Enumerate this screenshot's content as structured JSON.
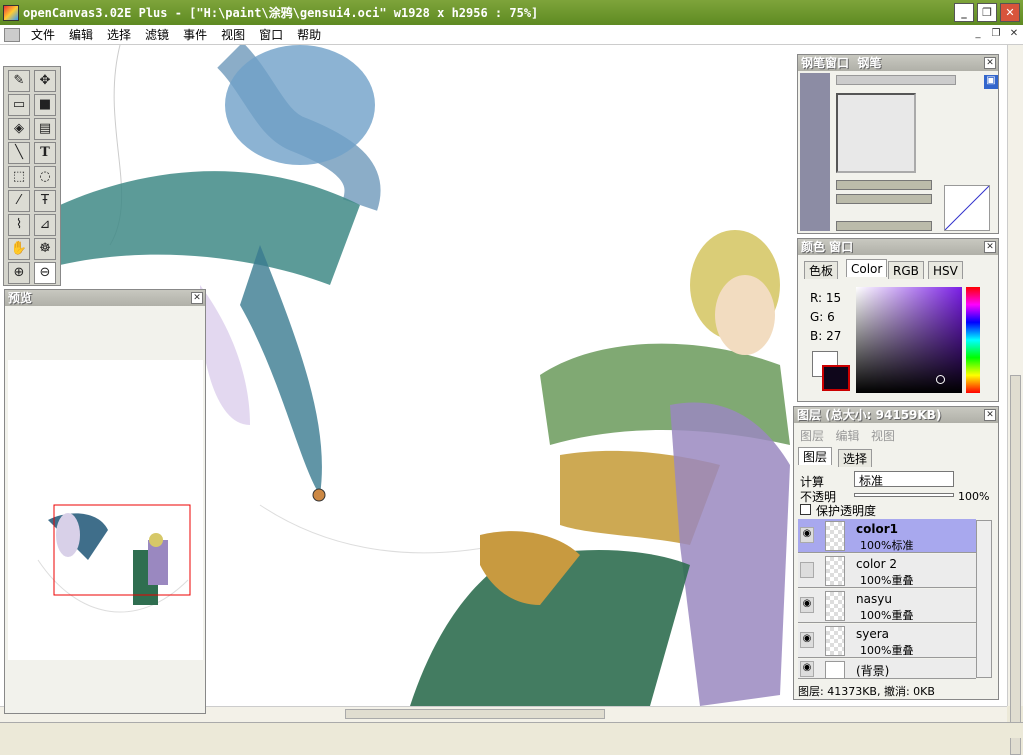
{
  "window": {
    "title": "openCanvas3.02E Plus - [\"H:\\paint\\涂鸦\\gensui4.oci\" w1928 x h2956 : 75%]"
  },
  "menu": [
    "文件",
    "编辑",
    "选择",
    "滤镜",
    "事件",
    "视图",
    "窗口",
    "帮助"
  ],
  "preview": {
    "title": "预览"
  },
  "pen_window": {
    "title": "钢笔窗口",
    "subtitle": "钢笔"
  },
  "color_window": {
    "title": "颜色 窗口",
    "tabs": [
      "色板",
      "Color",
      "RGB",
      "HSV"
    ],
    "r_label": "R:",
    "r": "15",
    "g_label": "G:",
    "g": "6",
    "b_label": "B:",
    "b": "27",
    "fg_color": "#0f061b"
  },
  "layers_window": {
    "title": "图层 (总大小: 94159KB)",
    "menu": [
      "图层",
      "编辑",
      "视图"
    ],
    "tabs": [
      "图层",
      "选择"
    ],
    "calc_label": "计算",
    "mode": "标准",
    "opacity_label": "不透明",
    "opacity": "100%",
    "protect_label": "保护透明度",
    "layers": [
      {
        "name": "color1",
        "mode": "100%标准",
        "visible": true
      },
      {
        "name": "color 2",
        "mode": "100%重叠",
        "visible": false
      },
      {
        "name": "nasyu",
        "mode": "100%重叠",
        "visible": true
      },
      {
        "name": "syera",
        "mode": "100%重叠",
        "visible": true
      },
      {
        "name": "(背景)",
        "mode": "",
        "visible": true
      }
    ],
    "status": "图层: 41373KB, 撤消: 0KB"
  }
}
